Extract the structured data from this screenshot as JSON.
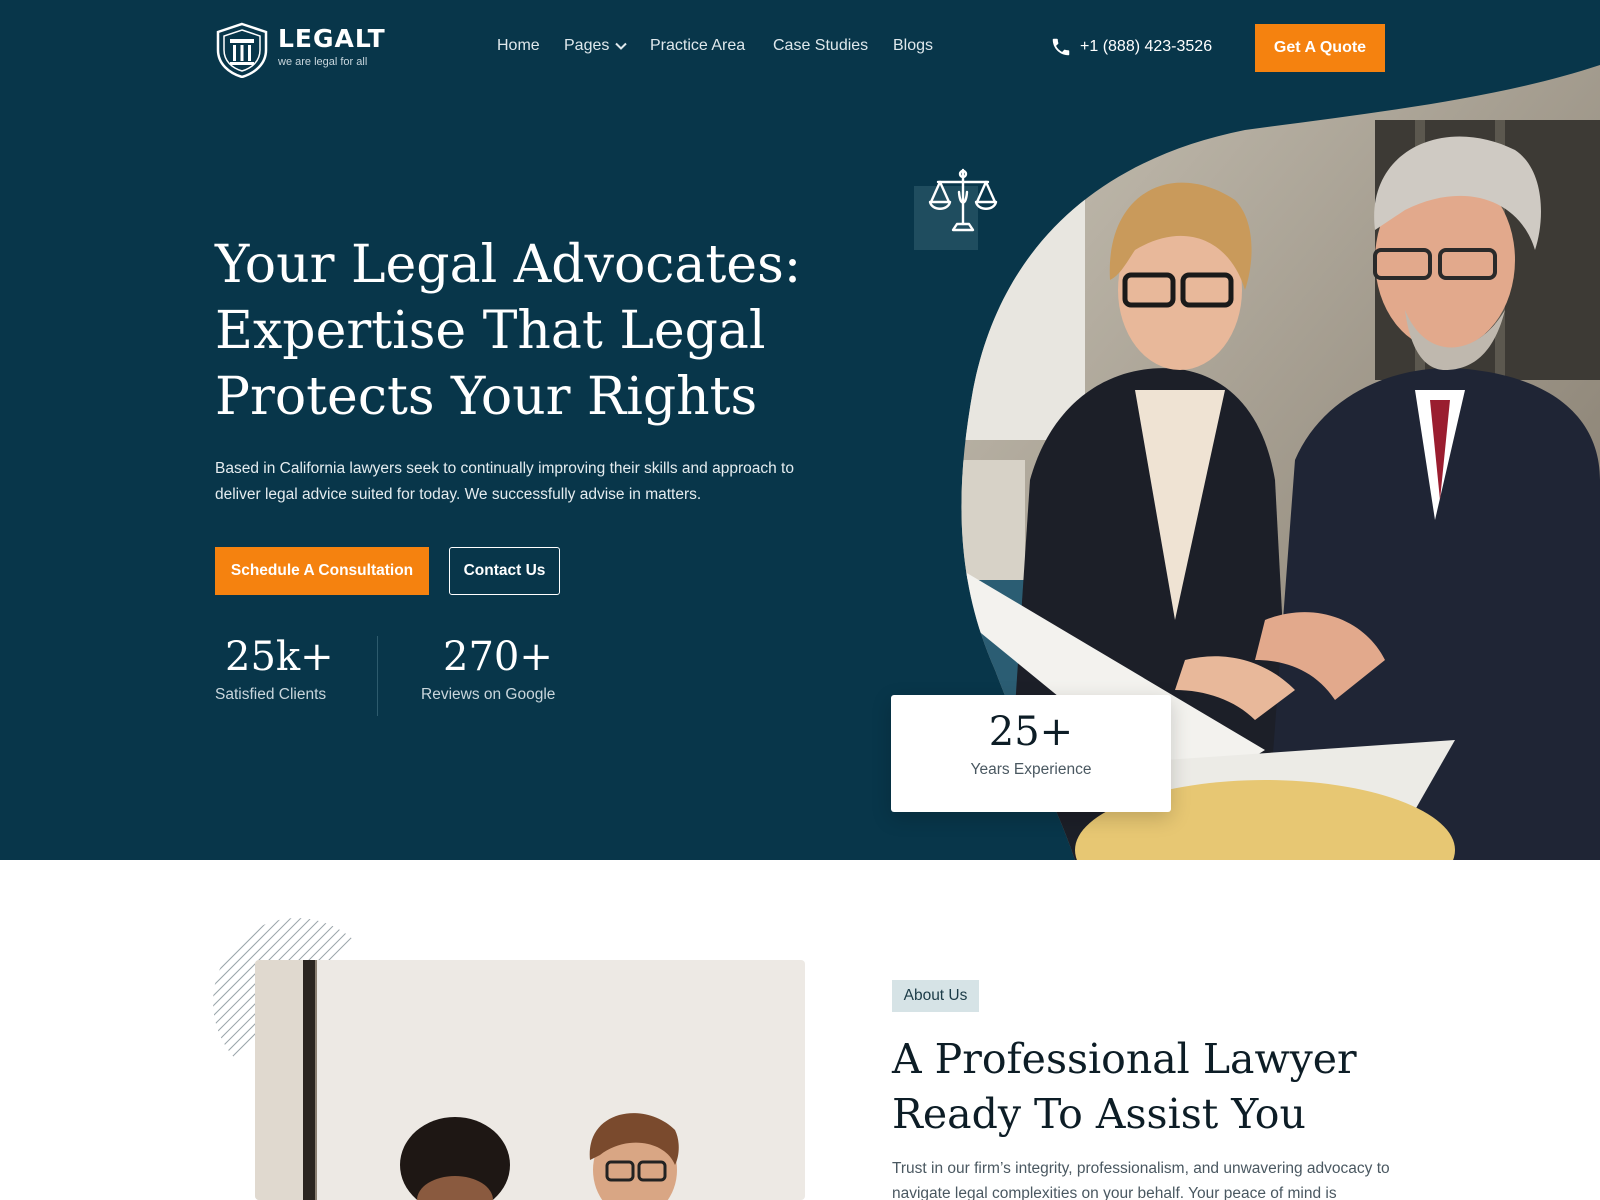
{
  "brand": {
    "name": "LEGALT",
    "tagline": "we are legal for all",
    "logo_icon": "shield-pillar-icon"
  },
  "nav": {
    "items": [
      {
        "label": "Home"
      },
      {
        "label": "Pages",
        "has_dropdown": true
      },
      {
        "label": "Practice Area"
      },
      {
        "label": "Case Studies"
      },
      {
        "label": "Blogs"
      }
    ],
    "phone_icon": "phone-icon",
    "phone": "+1 (888) 423-3526",
    "cta_label": "Get A Quote"
  },
  "hero": {
    "title": "Your Legal Advocates: Expertise That Legal Protects Your Rights",
    "description": "Based in California lawyers seek to continually improving their skills and approach to deliver legal advice suited for today. We successfully advise in matters.",
    "primary_button": "Schedule A Consultation",
    "secondary_button": "Contact Us",
    "stats": [
      {
        "value": "25k+",
        "label": "Satisfied Clients"
      },
      {
        "value": "270+",
        "label": "Reviews on Google"
      }
    ],
    "experience": {
      "value": "25+",
      "label": "Years Experience"
    },
    "decor_icon": "scales-of-justice-icon"
  },
  "about": {
    "badge": "About Us",
    "title": "A Professional Lawyer Ready To Assist You",
    "text": "Trust in our firm’s integrity, professionalism, and unwavering advocacy to navigate legal complexities on your behalf. Your peace of mind is"
  },
  "colors": {
    "hero_bg": "#08364a",
    "accent": "#f5820f",
    "white": "#ffffff",
    "badge_bg": "#d6e3e6"
  }
}
